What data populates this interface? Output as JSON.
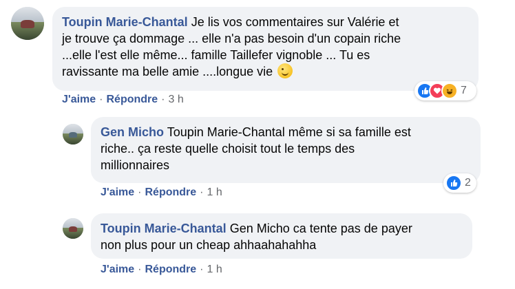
{
  "comments": [
    {
      "author": "Toupin Marie-Chantal",
      "text_line1": "Je lis vos commentaires sur Valérie et",
      "text_line2": "je trouve ça dommage ... elle n'a pas besoin d'un copain riche",
      "text_line3": "...elle l'est elle même... famille Taillefer vignoble ... Tu es",
      "text_line4": "ravissante ma belle amie ....longue vie",
      "emoji": "wink-emoji",
      "like_label": "J'aime",
      "reply_label": "Répondre",
      "time": "3 h",
      "reaction_count": "7",
      "reactions": [
        "like-icon",
        "love-icon",
        "haha-icon"
      ]
    },
    {
      "author": "Gen Micho",
      "text_line1": "Toupin Marie-Chantal même si sa famille est",
      "text_line2": "riche.. ça reste quelle choisit tout le temps des",
      "text_line3": "millionnaires",
      "like_label": "J'aime",
      "reply_label": "Répondre",
      "time": "1 h",
      "reaction_count": "2",
      "reactions": [
        "like-icon"
      ]
    },
    {
      "author": "Toupin Marie-Chantal",
      "text_line1": "Gen Micho ca tente pas de payer",
      "text_line2": "non plus pour un cheap ahhaahahahha",
      "like_label": "J'aime",
      "reply_label": "Répondre",
      "time": "1 h"
    }
  ],
  "colors": {
    "bubble": "#f0f2f5",
    "author": "#385898",
    "meta": "#65676b",
    "like": "#1877f2",
    "love": "#f33e58",
    "haha": "#f7b125"
  }
}
